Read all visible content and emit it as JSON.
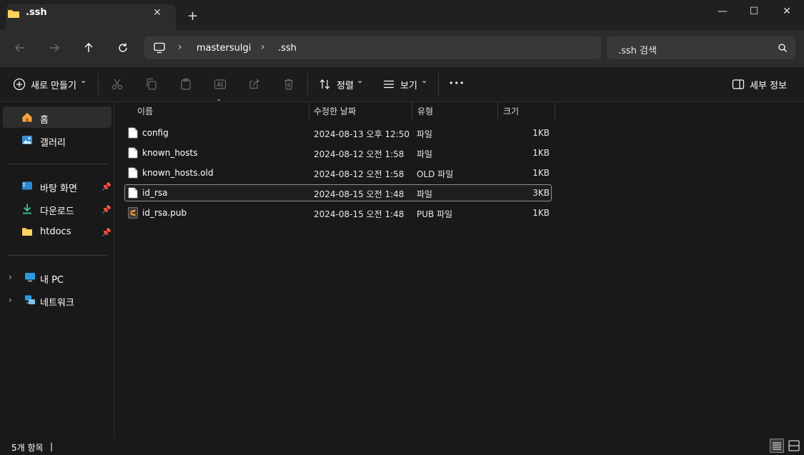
{
  "window": {
    "tab_title": ".ssh",
    "tab_close": "✕",
    "new_tab": "+",
    "minimize": "—",
    "maximize": "☐",
    "close": "✕"
  },
  "address": {
    "crumbs": [
      "mastersulgi",
      ".ssh"
    ],
    "separator": "›"
  },
  "search": {
    "placeholder": ".ssh 검색"
  },
  "toolbar": {
    "new_label": "새로 만들기",
    "sort_label": "정렬",
    "view_label": "보기",
    "more_label": "•••",
    "details_label": "세부 정보",
    "chevron": "⌄"
  },
  "sidebar": {
    "home": "홈",
    "gallery": "갤러리",
    "desktop": "바탕 화면",
    "downloads": "다운로드",
    "htdocs": "htdocs",
    "pc": "내 PC",
    "network": "네트워크"
  },
  "columns": {
    "name": "이름",
    "modified": "수정한 날짜",
    "type": "유형",
    "size": "크기"
  },
  "files": [
    {
      "name": "config",
      "modified": "2024-08-13 오후 12:50",
      "type": "파일",
      "size": "1KB",
      "icon": "file-icon"
    },
    {
      "name": "known_hosts",
      "modified": "2024-08-12 오전 1:58",
      "type": "파일",
      "size": "1KB",
      "icon": "file-icon"
    },
    {
      "name": "known_hosts.old",
      "modified": "2024-08-12 오전 1:58",
      "type": "OLD 파일",
      "size": "1KB",
      "icon": "file-icon"
    },
    {
      "name": "id_rsa",
      "modified": "2024-08-15 오전 1:48",
      "type": "파일",
      "size": "3KB",
      "icon": "file-icon"
    },
    {
      "name": "id_rsa.pub",
      "modified": "2024-08-15 오전 1:48",
      "type": "PUB 파일",
      "size": "1KB",
      "icon": "sublime-file-icon"
    }
  ],
  "selected_row": "id_rsa",
  "status": {
    "count": "5개 항목",
    "cursor": "|"
  },
  "colors": {
    "accent": "#4cc2ff",
    "folder": "#f3c03e",
    "background": "#191919"
  }
}
